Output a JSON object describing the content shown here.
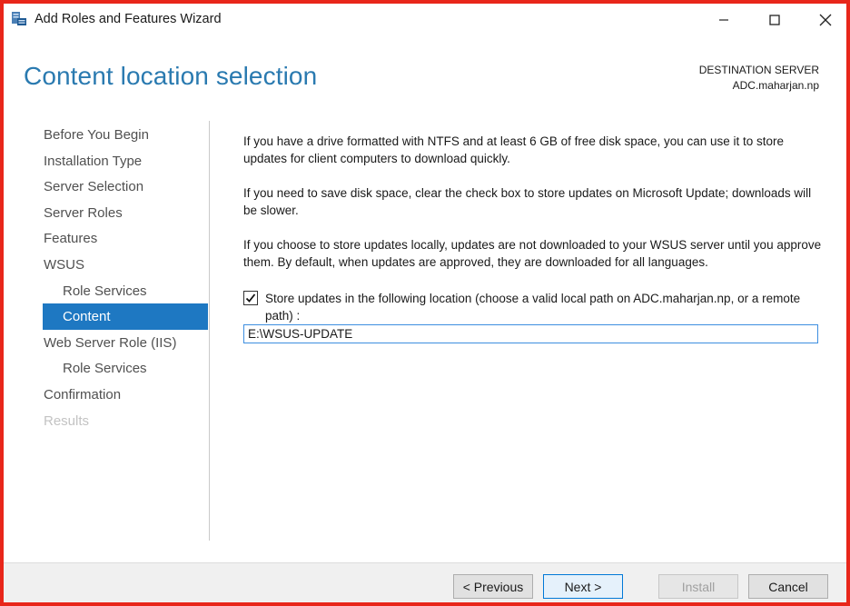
{
  "window": {
    "title": "Add Roles and Features Wizard",
    "icon": "server-manager-icon"
  },
  "header": {
    "page_title": "Content location selection",
    "destination_label": "DESTINATION SERVER",
    "destination_server": "ADC.maharjan.np"
  },
  "sidebar": {
    "items": [
      {
        "label": "Before You Begin",
        "state": "normal"
      },
      {
        "label": "Installation Type",
        "state": "normal"
      },
      {
        "label": "Server Selection",
        "state": "normal"
      },
      {
        "label": "Server Roles",
        "state": "normal"
      },
      {
        "label": "Features",
        "state": "normal"
      },
      {
        "label": "WSUS",
        "state": "normal"
      },
      {
        "label": "Role Services",
        "state": "normal",
        "indent": true
      },
      {
        "label": "Content",
        "state": "active",
        "indent": true
      },
      {
        "label": "Web Server Role (IIS)",
        "state": "normal"
      },
      {
        "label": "Role Services",
        "state": "normal",
        "indent": true
      },
      {
        "label": "Confirmation",
        "state": "normal"
      },
      {
        "label": "Results",
        "state": "disabled"
      }
    ]
  },
  "content": {
    "paragraphs": [
      "If you have a drive formatted with NTFS and at least 6 GB of free disk space, you can use it to store updates for client computers to download quickly.",
      "If you need to save disk space, clear the check box to store updates on Microsoft Update; downloads will be slower.",
      "If you choose to store updates locally, updates are not downloaded to your WSUS server until you approve them. By default, when updates are approved, they are downloaded for all languages."
    ],
    "checkbox_label": "Store updates in the following location (choose a valid local path on ADC.maharjan.np, or a remote path) :",
    "checkbox_checked": true,
    "path_value": "E:\\WSUS-UPDATE"
  },
  "footer": {
    "previous_label": "< Previous",
    "next_label": "Next >",
    "install_label": "Install",
    "cancel_label": "Cancel"
  },
  "colors": {
    "accent": "#1e78c2",
    "title_blue": "#2a7ab0",
    "frame": "#e8261a"
  }
}
